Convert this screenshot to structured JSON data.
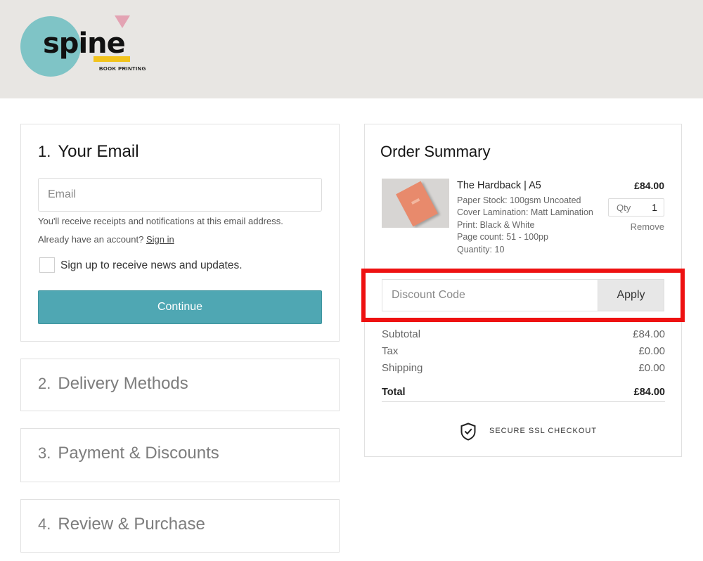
{
  "brand": {
    "logo_text": "spine",
    "logo_subtitle": "BOOK PRINTING",
    "colors": {
      "circle": "#7fc4c6",
      "triangle": "#e3a3b3",
      "bar": "#f2c31c"
    }
  },
  "steps": [
    {
      "number": "1.",
      "title": "Your Email",
      "state": "active"
    },
    {
      "number": "2.",
      "title": "Delivery Methods",
      "state": "collapsed"
    },
    {
      "number": "3.",
      "title": "Payment & Discounts",
      "state": "collapsed"
    },
    {
      "number": "4.",
      "title": "Review & Purchase",
      "state": "collapsed"
    }
  ],
  "email_step": {
    "placeholder": "Email",
    "helper_text": "You'll receive receipts and notifications at this email address.",
    "account_prompt": "Already have an account?",
    "sign_in_link": "Sign in",
    "newsletter_label": "Sign up to receive news and updates.",
    "newsletter_checked": false,
    "continue_label": "Continue",
    "accent_color": "#4fa7b3"
  },
  "summary": {
    "title": "Order Summary",
    "item": {
      "name": "The Hardback | A5",
      "details": [
        "Paper Stock: 100gsm Uncoated",
        "Cover Lamination: Matt Lamination",
        "Print: Black & White",
        "Page count: 51 - 100pp",
        "Quantity: 10"
      ],
      "price": "£84.00",
      "qty_label": "Qty",
      "qty_value": "1",
      "remove_label": "Remove"
    },
    "discount": {
      "placeholder": "Discount Code",
      "apply_label": "Apply",
      "highlight_color": "#ee1111"
    },
    "rows": [
      {
        "label": "Subtotal",
        "value": "£84.00"
      },
      {
        "label": "Tax",
        "value": "£0.00"
      },
      {
        "label": "Shipping",
        "value": "£0.00"
      }
    ],
    "total": {
      "label": "Total",
      "value": "£84.00"
    },
    "secure_text": "SECURE SSL CHECKOUT",
    "secure_icon": "shield-check-icon"
  }
}
